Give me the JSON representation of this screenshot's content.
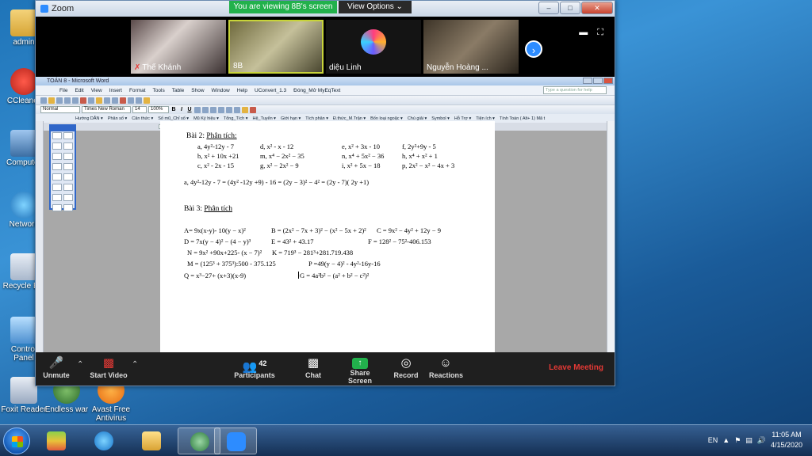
{
  "desktop": {
    "icons": [
      {
        "label": "admin"
      },
      {
        "label": "CCleaner"
      },
      {
        "label": "Computer"
      },
      {
        "label": "Network"
      },
      {
        "label": "Recycle Bin"
      },
      {
        "label": "Control Panel"
      },
      {
        "label": "Foxit Reader"
      },
      {
        "label": "Endless war"
      },
      {
        "label": "Avast Free Antivirus"
      }
    ]
  },
  "zoom": {
    "window_title": "Zoom",
    "viewing_banner": "You are viewing 8B's screen",
    "view_options": "View Options ⌄",
    "participants": [
      {
        "name": "Thế Khánh",
        "muted": true
      },
      {
        "name": "8B",
        "muted": false
      },
      {
        "name": "diệu Linh",
        "muted": false
      },
      {
        "name": "Nguyễn Hoàng ...",
        "muted": false
      }
    ],
    "controls": {
      "unmute": "Unmute",
      "start_video": "Start Video",
      "participants": "Participants",
      "participants_count": "42",
      "chat": "Chat",
      "share_screen": "Share Screen",
      "record": "Record",
      "reactions": "Reactions",
      "leave": "Leave Meeting"
    }
  },
  "word": {
    "title": "TOÁN 8 - Microsoft Word",
    "menu": [
      "File",
      "Edit",
      "View",
      "Insert",
      "Format",
      "Tools",
      "Table",
      "Show",
      "Window",
      "Help",
      "UConvert_1.3",
      "Đóng_Mở MyEqText"
    ],
    "help_placeholder": "Type a question for help",
    "style": "Normal",
    "font": "Times New Roman",
    "size": "14",
    "zoom": "100%",
    "addins": [
      "Hướng DẪN ▾",
      "Phân số ▾",
      "Căn thức ▾",
      "Số mũ_Chỉ số ▾",
      "Mũ Ký hiệu ▾",
      "Tổng_Tích ▾",
      "Hệ_Tuyển ▾",
      "Giới hạn ▾",
      "Tích phân ▾",
      "Đ.thức_M.Trận ▾",
      "Bốn loại ngoặc ▾",
      "Chú giải ▾",
      "Symbol ▾",
      "Hỗ Trợ ▾",
      "Tiện ích ▾",
      "Tính Toán ( Alt+ 1) Mã t"
    ],
    "doc": {
      "bai2_title": "Bài 2:",
      "bai2_sub": "Phân tích:",
      "bai2_rows": [
        [
          "a, 4y²-12y - 7",
          "d, x² - x - 12",
          "e, x² + 3x - 10",
          "f, 2y²+9y - 5"
        ],
        [
          "b, x² + 10x +21",
          "m, x⁴ − 2x² − 35",
          "n, x⁴ + 5x² − 36",
          "h, x⁴ + x² + 1"
        ],
        [
          "c, x² - 2x - 15",
          "g, x² − 2x² − 9",
          "i, x² + 5x − 18",
          "p, 2x² − x² − 4x + 3"
        ]
      ],
      "solution_a": "a, 4y²-12y - 7 = (4y² -12y +9) - 16 = (2y − 3)² − 4² = (2y - 7)( 2y +1)",
      "bai3_title": "Bài 3:",
      "bai3_sub": "Phân tích",
      "bai3_rows": [
        [
          "A= 9x(x-y)- 10(y − x)²",
          "B = (2x² − 7x + 3)² − (x² − 5x + 2)²",
          "C = 9x² − 4y² + 12y − 9"
        ],
        [
          "D = 7x(y − 4)² − (4 − y)³",
          "E = 43² + 43.17",
          "F = 128² − 75²-406.153"
        ],
        [
          "N = 9x² +90x+225- (x − 7)²",
          "K = 719³ − 281³+281.719.438",
          ""
        ],
        [
          "M = (125³ + 375³):500 - 375.125",
          "P =49(y − 4)² - 4y²-16y-16",
          ""
        ],
        [
          "Q = x³−27+ (x+3)(x-9)",
          "G = 4a²b² − (a² + b² − c²)²",
          ""
        ]
      ]
    }
  },
  "taskbar": {
    "language": "EN",
    "time": "11:05 AM",
    "date": "4/15/2020"
  }
}
